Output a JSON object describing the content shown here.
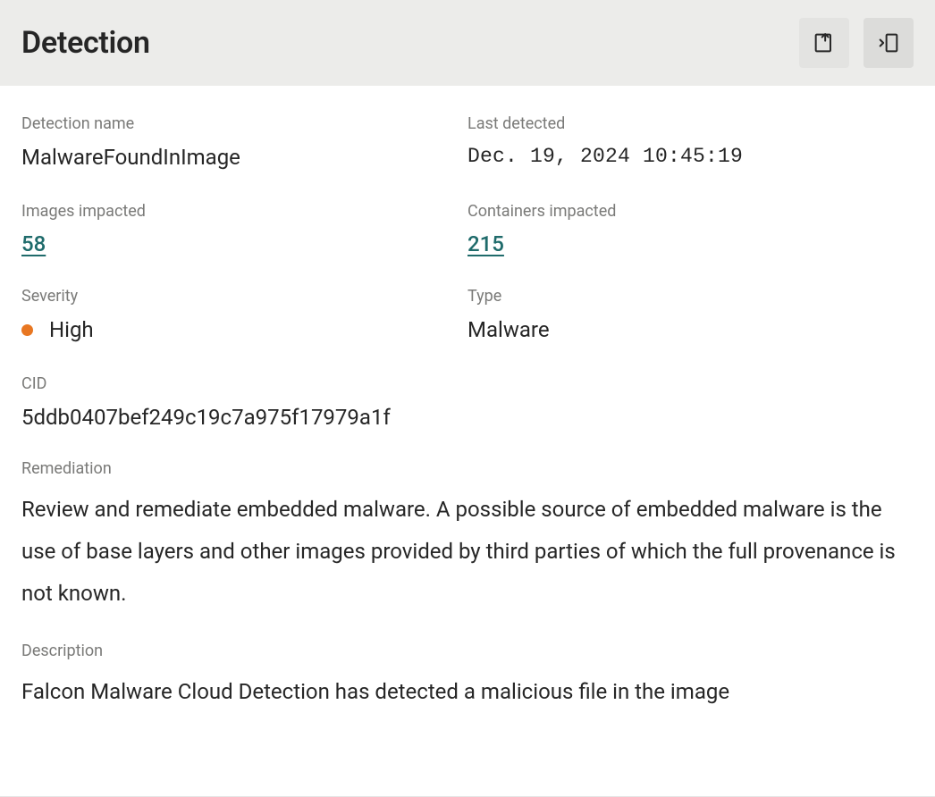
{
  "header": {
    "title": "Detection"
  },
  "fields": {
    "detection_name": {
      "label": "Detection name",
      "value": "MalwareFoundInImage"
    },
    "last_detected": {
      "label": "Last detected",
      "value": "Dec. 19, 2024 10:45:19"
    },
    "images_impacted": {
      "label": "Images impacted",
      "value": "58"
    },
    "containers_impacted": {
      "label": "Containers impacted",
      "value": "215"
    },
    "severity": {
      "label": "Severity",
      "value": "High",
      "dot_color": "#e87722"
    },
    "type": {
      "label": "Type",
      "value": "Malware"
    },
    "cid": {
      "label": "CID",
      "value": "5ddb0407bef249c19c7a975f17979a1f"
    },
    "remediation": {
      "label": "Remediation",
      "value": "Review and remediate embedded malware. A possible source of embedded malware is the use of base layers and other images provided by third parties of which the full provenance is not known."
    },
    "description": {
      "label": "Description",
      "value": "Falcon Malware Cloud Detection has detected a malicious file in the image"
    }
  }
}
